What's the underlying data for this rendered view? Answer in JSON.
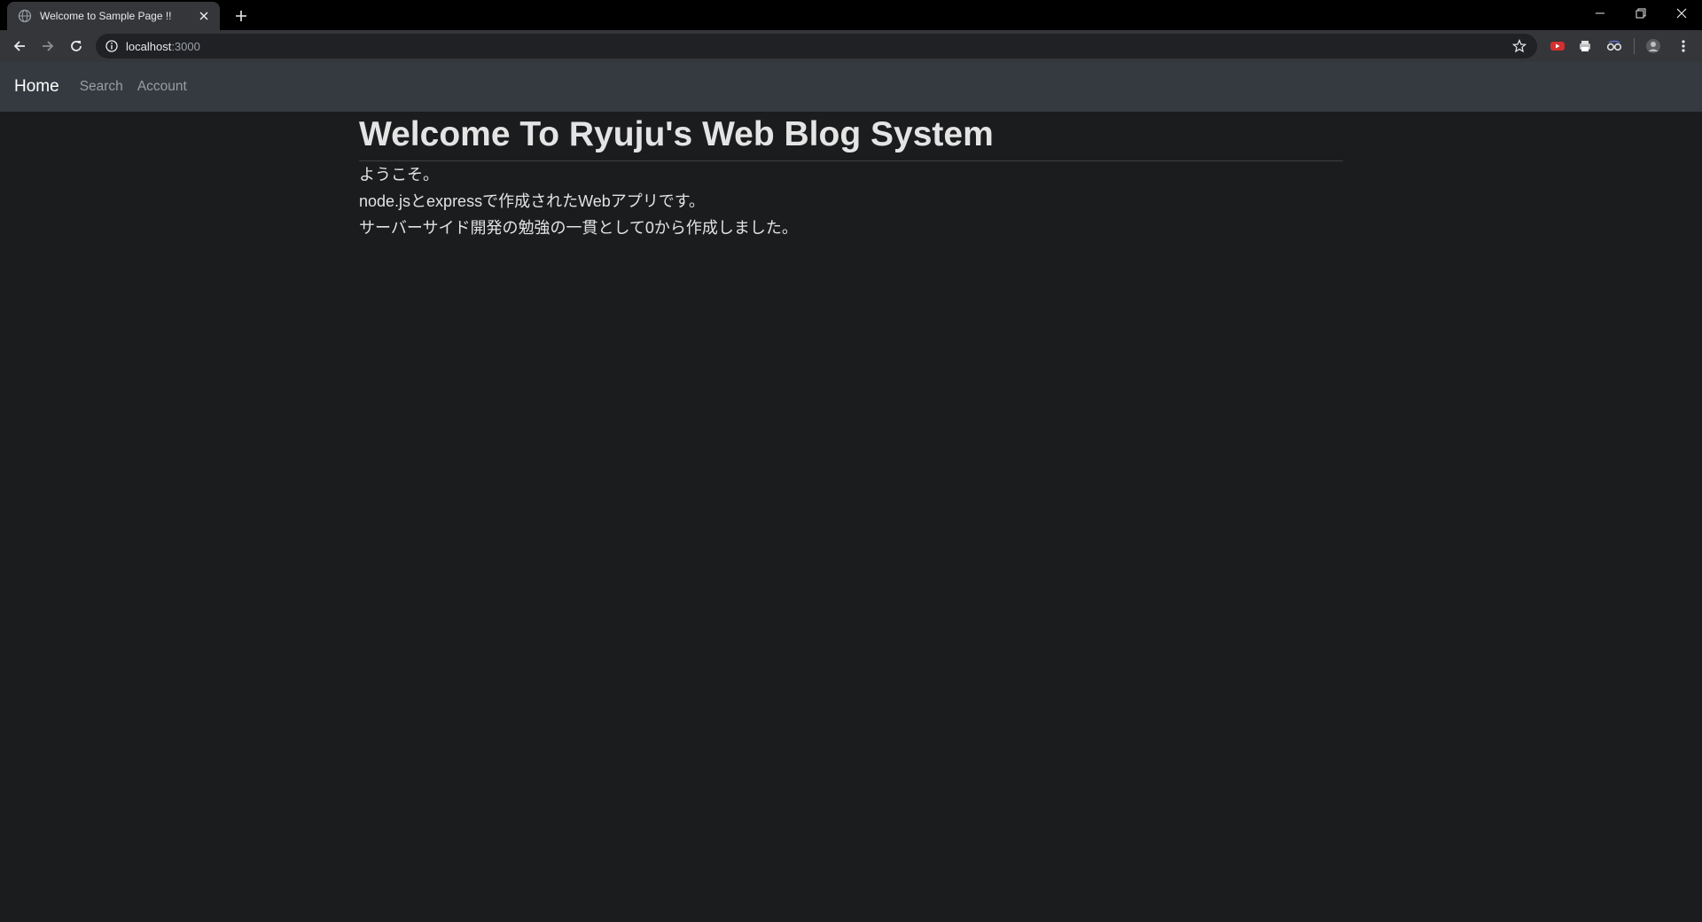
{
  "browser": {
    "tab_title": "Welcome to Sample Page !!",
    "url_host": "localhost",
    "url_port": ":3000"
  },
  "navbar": {
    "brand": "Home",
    "links": [
      "Search",
      "Account"
    ]
  },
  "main": {
    "heading": "Welcome To Ryuju's Web Blog System",
    "lines": [
      "ようこそ。",
      "node.jsとexpressで作成されたWebアプリです。",
      "サーバーサイド開発の勉強の一貫として0から作成しました。"
    ]
  },
  "colors": {
    "page_bg": "#1b1c1e",
    "navbar_bg": "#343a40",
    "tabstrip_bg": "#000000",
    "toolbar_bg": "#35363a"
  }
}
